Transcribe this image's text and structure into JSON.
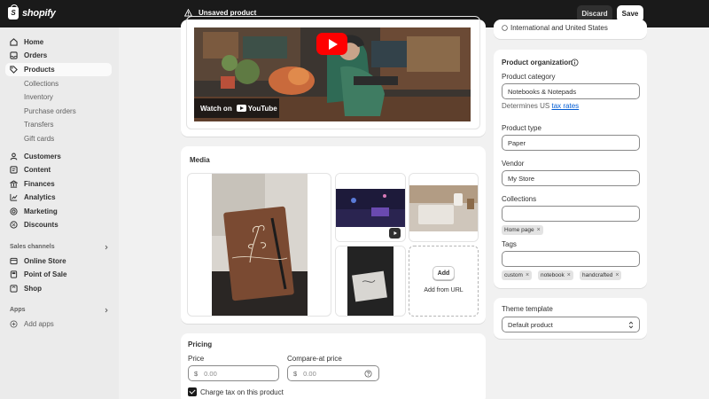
{
  "topbar": {
    "brand": "shopify",
    "logo_letter": "S",
    "status": "Unsaved product",
    "discard": "Discard",
    "save": "Save"
  },
  "sidebar": {
    "items": [
      {
        "label": "Home",
        "icon": "home-icon"
      },
      {
        "label": "Orders",
        "icon": "orders-icon"
      },
      {
        "label": "Products",
        "icon": "tag-icon",
        "active": true
      },
      {
        "label": "Collections"
      },
      {
        "label": "Inventory"
      },
      {
        "label": "Purchase orders"
      },
      {
        "label": "Transfers"
      },
      {
        "label": "Gift cards"
      },
      {
        "label": "Customers",
        "icon": "person-icon"
      },
      {
        "label": "Content",
        "icon": "content-icon"
      },
      {
        "label": "Finances",
        "icon": "bank-icon"
      },
      {
        "label": "Analytics",
        "icon": "chart-icon"
      },
      {
        "label": "Marketing",
        "icon": "target-icon"
      },
      {
        "label": "Discounts",
        "icon": "discount-icon"
      }
    ],
    "sales_channels_label": "Sales channels",
    "channels": [
      {
        "label": "Online Store",
        "icon": "store-icon"
      },
      {
        "label": "Point of Sale",
        "icon": "pos-icon"
      },
      {
        "label": "Shop",
        "icon": "shop-icon"
      }
    ],
    "apps_label": "Apps",
    "add_apps": "Add apps"
  },
  "video": {
    "watch_on": "Watch on",
    "youtube": "YouTube"
  },
  "media": {
    "title": "Media",
    "add": "Add",
    "add_from_url": "Add from URL"
  },
  "pricing": {
    "title": "Pricing",
    "price_label": "Price",
    "compare_label": "Compare-at price",
    "currency": "$",
    "price_placeholder": "0.00",
    "compare_placeholder": "0.00",
    "charge_tax": "Charge tax on this product",
    "charge_tax_checked": true
  },
  "markets": {
    "partial_text": "International and United States"
  },
  "organization": {
    "title": "Product organization",
    "category_label": "Product category",
    "category_value": "Notebooks & Notepads",
    "determines_text": "Determines US",
    "tax_rates_link": "tax rates",
    "type_label": "Product type",
    "type_value": "Paper",
    "vendor_label": "Vendor",
    "vendor_value": "My Store",
    "collections_label": "Collections",
    "collections": [
      "Home page"
    ],
    "tags_label": "Tags",
    "tags": [
      "custom",
      "notebook",
      "handcrafted"
    ]
  },
  "theme": {
    "title": "Theme template",
    "value": "Default product"
  },
  "colors": {
    "topbar_bg": "#1a1a1a",
    "youtube_red": "#ff0000",
    "link_blue": "#005bd3"
  }
}
